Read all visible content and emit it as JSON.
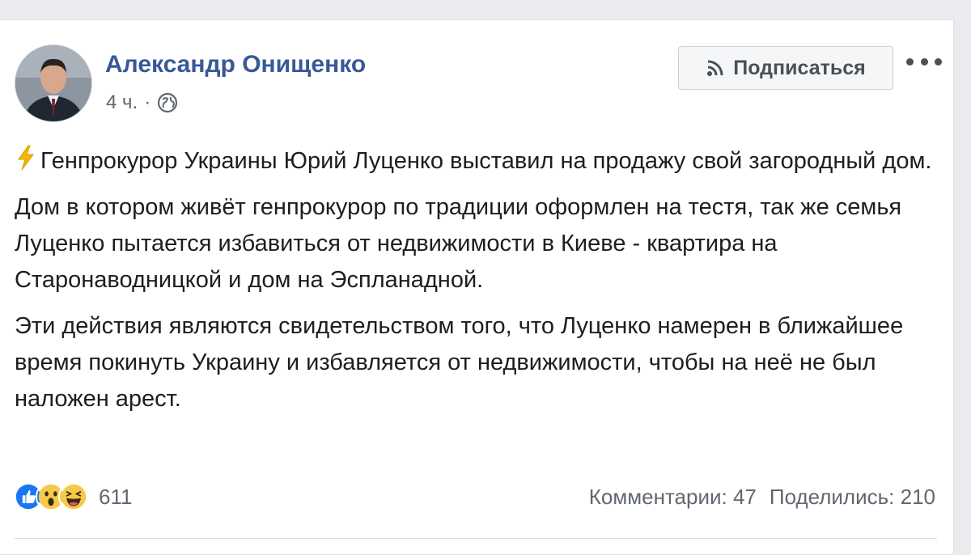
{
  "post": {
    "author": "Александр Онищенко",
    "time": "4 ч.",
    "time_separator": "·",
    "subscribe_label": "Подписаться",
    "paragraphs": [
      "Генпрокурор Украины Юрий Луценко выставил на продажу свой загородный дом.",
      "Дом в котором живёт генпрокурор по традиции оформлен на тестя, так же семья Луценко пытается избавиться от недвижимости в Киеве - квартира на Старонаводницкой и дом на Эспланадной.",
      "Эти действия являются свидетельством того, что Луценко намерен в ближайшее время покинуть Украину и избавляется от недвижимости, чтобы на неё не был наложен арест."
    ]
  },
  "footer": {
    "reaction_count": "611",
    "comments": "Комментарии: 47",
    "shares": "Поделились: 210"
  },
  "icons": {
    "privacy": "globe-icon",
    "subscribe": "rss-icon",
    "more": "more-options-icon",
    "emoji": "lightning-icon",
    "reactions": [
      "like-icon",
      "wow-icon",
      "haha-icon"
    ]
  },
  "colors": {
    "author": "#385898",
    "text": "#1c1e21",
    "secondary": "#606770",
    "like": "#1877f2",
    "emoji_yellow": "#f7c948"
  }
}
